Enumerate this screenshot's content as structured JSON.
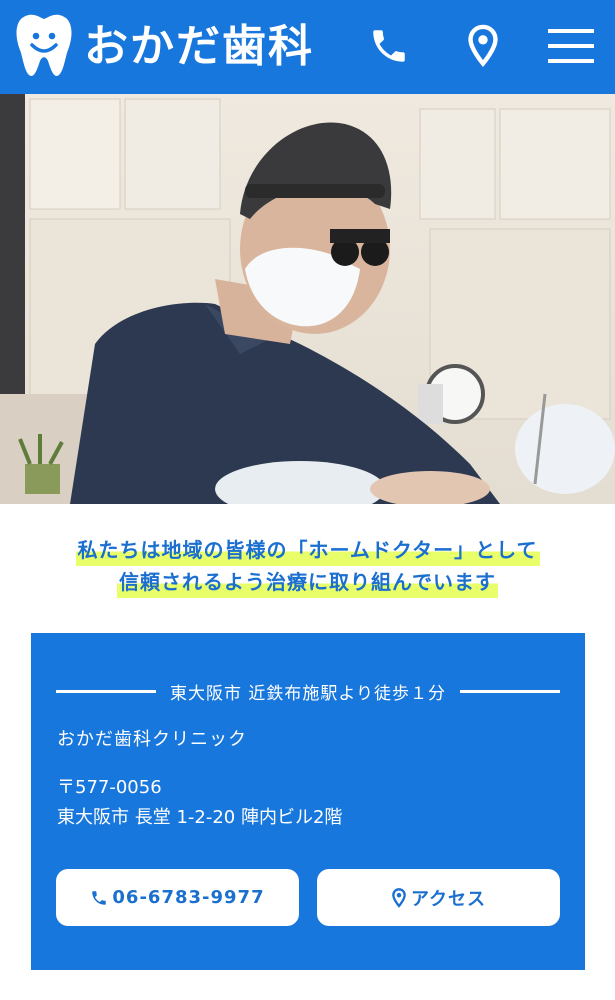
{
  "header": {
    "logo_text": "おかだ歯科",
    "brand_color": "#1877dc",
    "icons": [
      "tooth-logo",
      "phone-icon",
      "map-pin-icon",
      "hamburger-menu-icon"
    ]
  },
  "hero": {
    "image_subject": "dentist-with-loupes-photo"
  },
  "tagline": {
    "line1": "私たちは地域の皆様の「ホームドクター」として",
    "line2": "信頼されるよう治療に取り組んでいます",
    "highlight_color": "#e9ff6a",
    "text_color": "#1b6fcf"
  },
  "info": {
    "access_text": "東大阪市 近鉄布施駅より徒歩１分",
    "clinic_name": "おかだ歯科クリニック",
    "postal": "〒577-0056",
    "address": "東大阪市 長堂 1-2-20 陣内ビル2階",
    "tel_label": "06-6783-9977",
    "access_label": "アクセス"
  }
}
